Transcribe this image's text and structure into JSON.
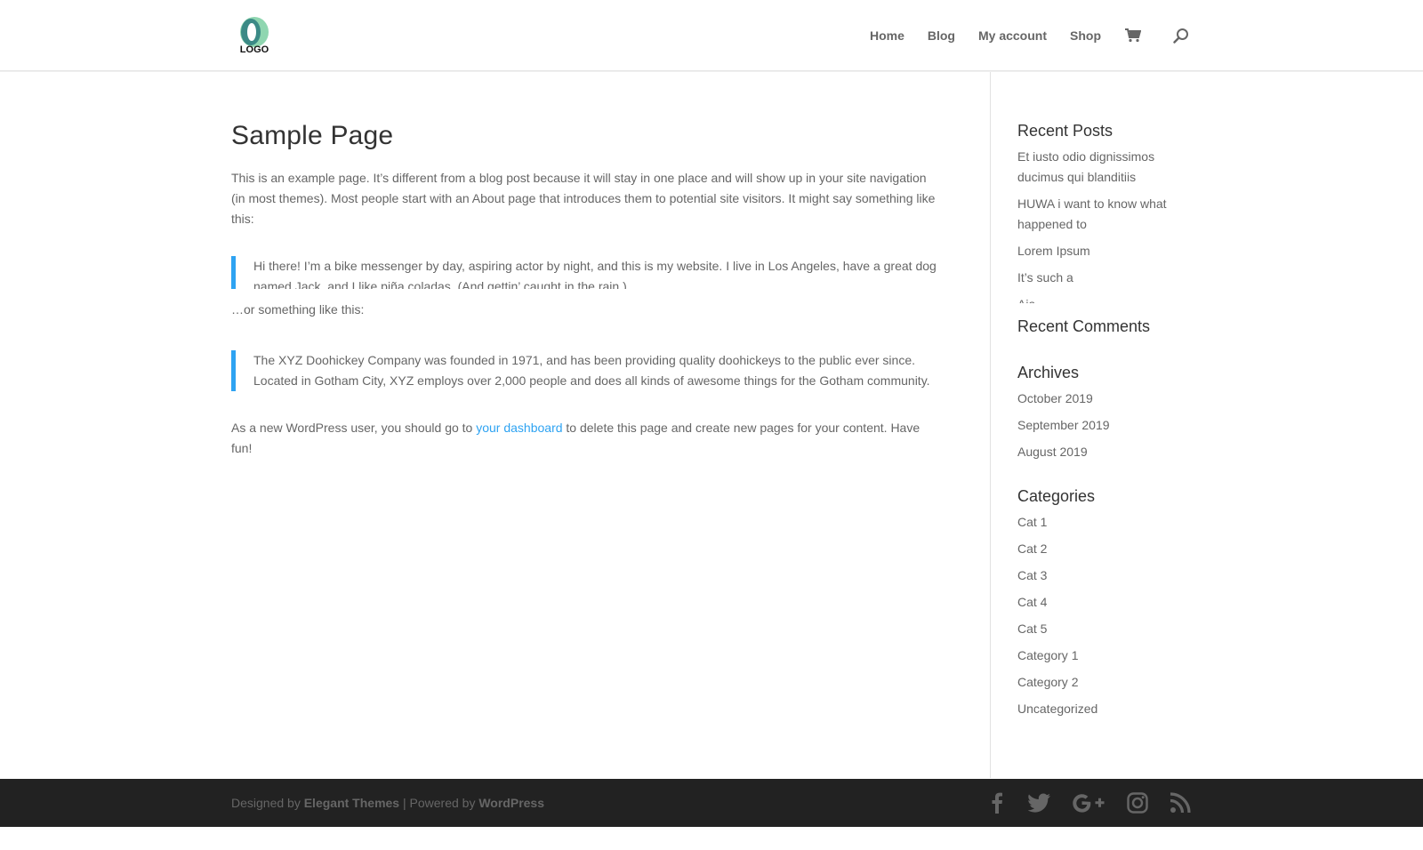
{
  "colors": {
    "accent": "#2ea3f2",
    "footer_bg": "#222222",
    "text": "#666666",
    "heading": "#333333"
  },
  "header": {
    "logo_text": "LOGO",
    "nav": [
      {
        "label": "Home"
      },
      {
        "label": "Blog"
      },
      {
        "label": "My account"
      },
      {
        "label": "Shop"
      }
    ],
    "cart_icon": "cart-icon",
    "search_icon": "search-icon"
  },
  "content": {
    "title": "Sample Page",
    "para1": "This is an example page. It’s different from a blog post because it will stay in one place and will show up in your site navigation (in most themes). Most people start with an About page that introduces them to potential site visitors. It might say something like this:",
    "quote1": "Hi there! I’m a bike messenger by day, aspiring actor by night, and this is my website. I live in Los Angeles, have a great dog named Jack, and I like piña coladas. (And gettin’ caught in the rain.)",
    "para2": "…or something like this:",
    "quote2": "The XYZ Doohickey Company was founded in 1971, and has been providing quality doohickeys to the public ever since. Located in Gotham City, XYZ employs over 2,000 people and does all kinds of awesome things for the Gotham community.",
    "para3_before": "As a new WordPress user, you should go to ",
    "para3_link": "your dashboard",
    "para3_after": " to delete this page and create new pages for your content. Have fun!"
  },
  "sidebar": {
    "recent_posts": {
      "title": "Recent Posts",
      "items": [
        "Et iusto odio dignissimos ducimus qui blanditiis",
        "HUWA i want to know what happened to",
        "Lorem Ipsum",
        "It’s such a",
        "Aja"
      ]
    },
    "recent_comments": {
      "title": "Recent Comments"
    },
    "archives": {
      "title": "Archives",
      "items": [
        "October 2019",
        "September 2019",
        "August 2019"
      ]
    },
    "categories": {
      "title": "Categories",
      "items": [
        "Cat 1",
        "Cat 2",
        "Cat 3",
        "Cat 4",
        "Cat 5",
        "Category 1",
        "Category 2",
        "Uncategorized"
      ]
    }
  },
  "footer": {
    "designed_by": "Designed by ",
    "elegant": "Elegant Themes",
    "sep": " | Powered by ",
    "wordpress": "WordPress",
    "social": [
      "facebook-icon",
      "twitter-icon",
      "google-plus-icon",
      "instagram-icon",
      "rss-icon"
    ]
  }
}
